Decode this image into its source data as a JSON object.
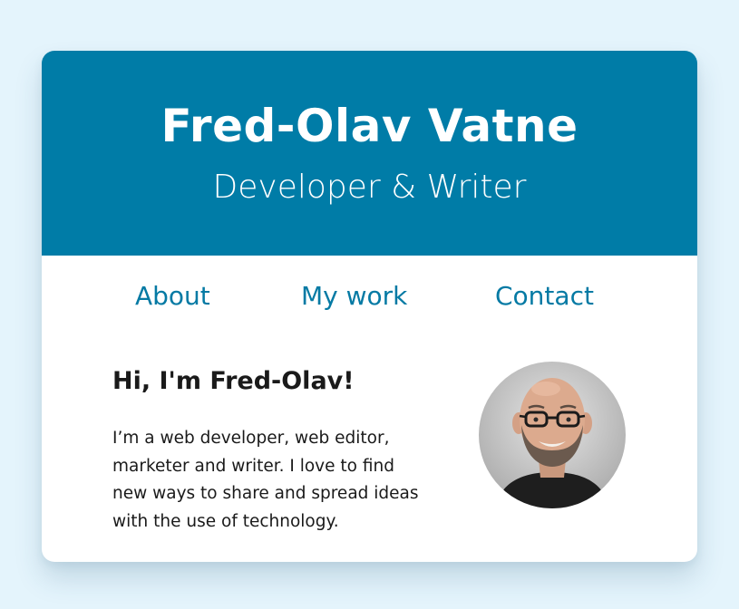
{
  "header": {
    "name": "Fred-Olav Vatne",
    "tagline": "Developer & Writer"
  },
  "nav": {
    "items": [
      {
        "label": "About"
      },
      {
        "label": "My work"
      },
      {
        "label": "Contact"
      }
    ]
  },
  "intro": {
    "greeting": "Hi, I'm Fred-Olav!",
    "bio": "I’m a web developer, web editor, marketer and writer. I love to find new ways to share and spread ideas with the use of technology."
  },
  "colors": {
    "page_background": "#e4f4fc",
    "header_background": "#007ca7",
    "link": "#057aa4",
    "card_background": "#ffffff"
  },
  "icons": {
    "avatar": "portrait-photo-icon"
  }
}
